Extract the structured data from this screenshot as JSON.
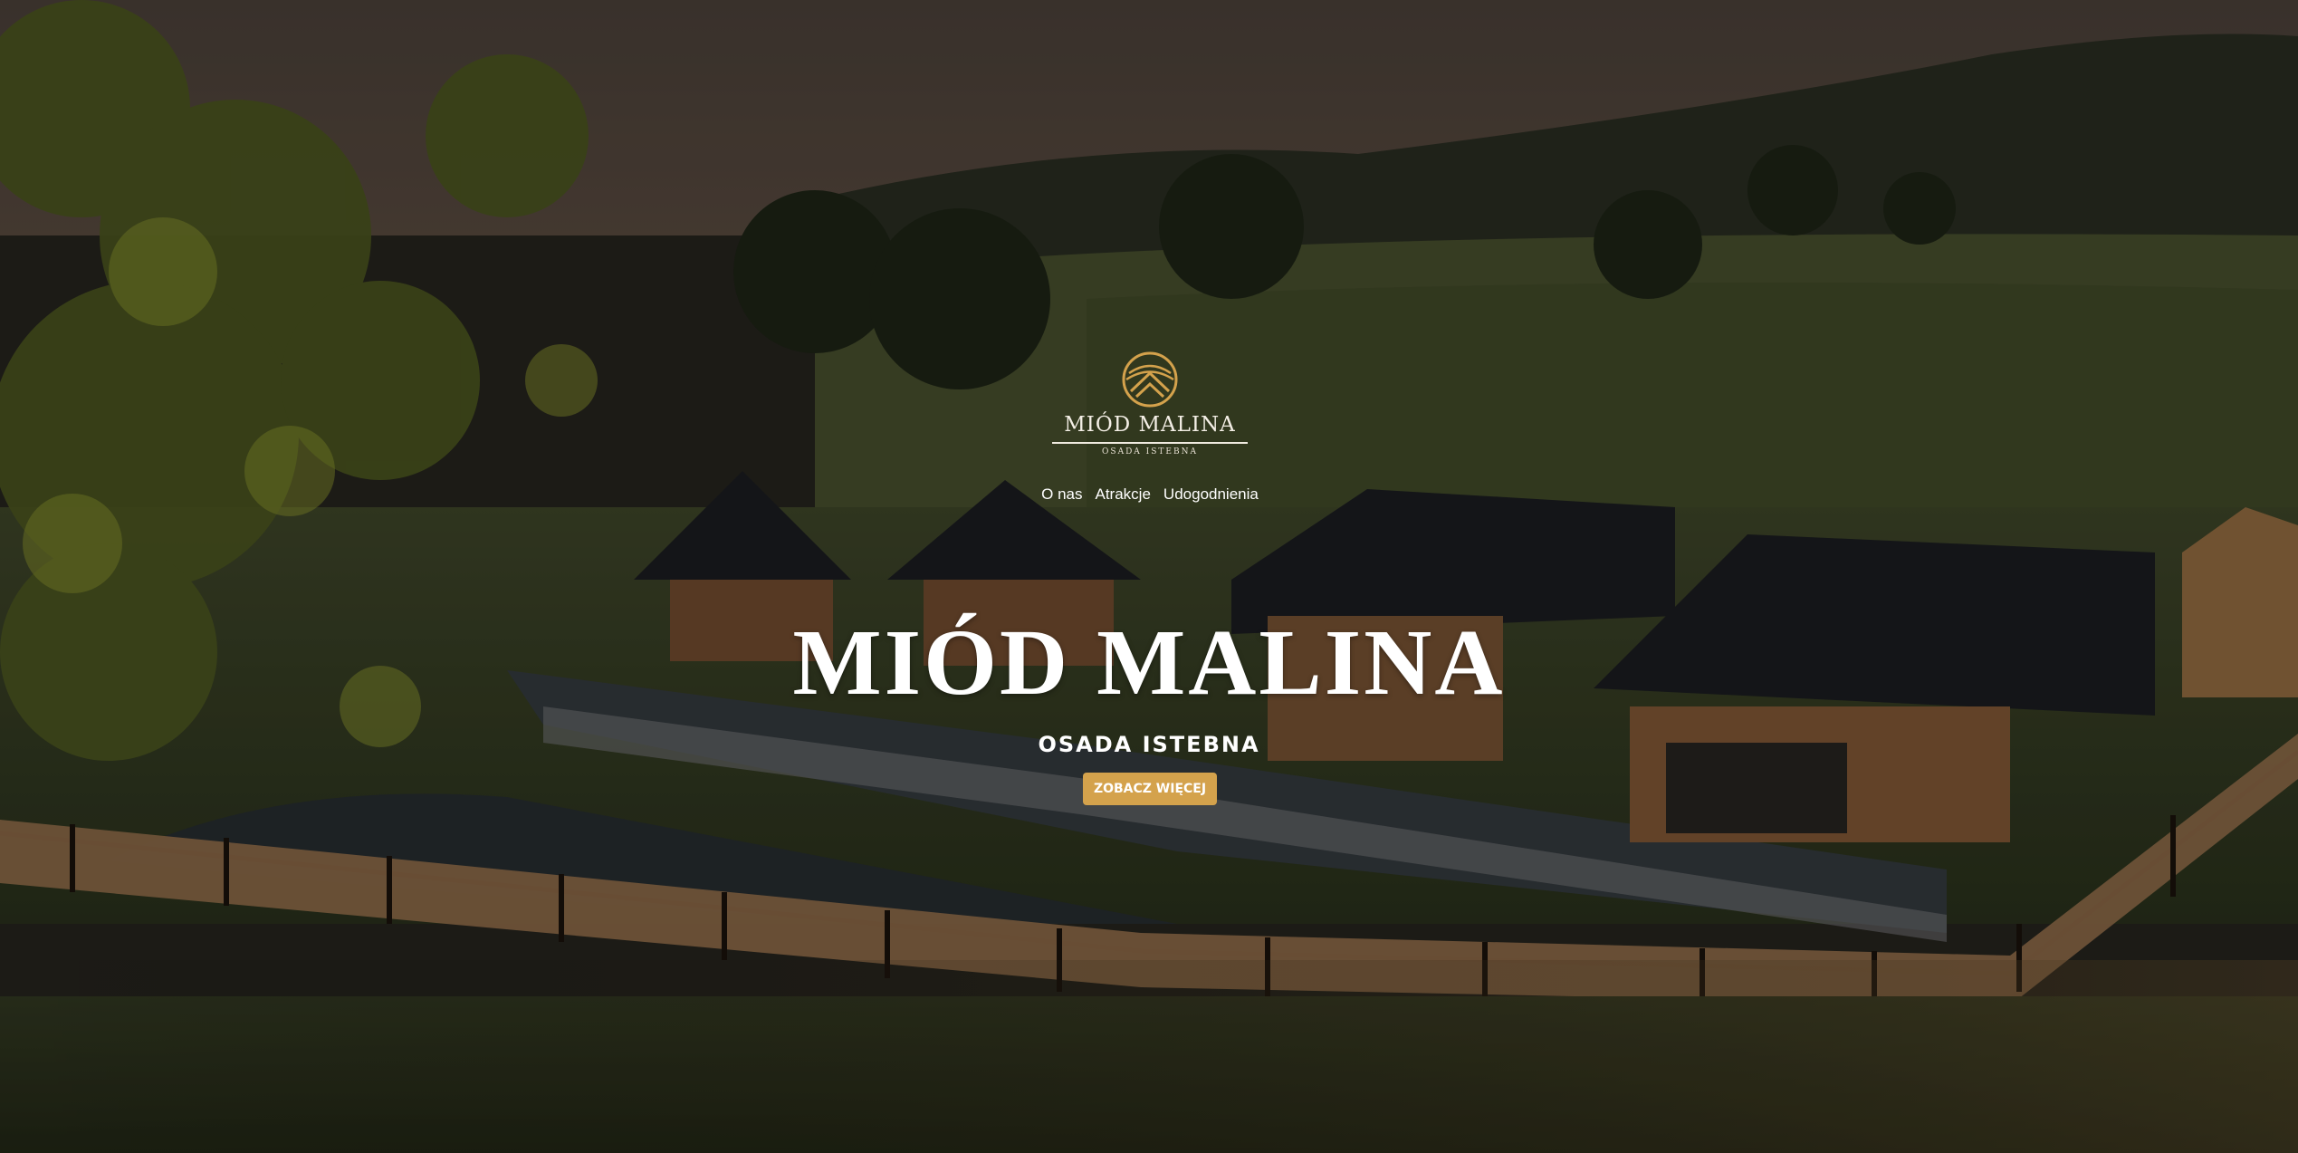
{
  "brand": {
    "name": "MIÓD MALINA",
    "tagline": "OSADA ISTEBNA",
    "logo_icon": "mountain-emblem-icon",
    "accent_color": "#d4a24c"
  },
  "nav": {
    "items": [
      {
        "label": "O nas"
      },
      {
        "label": "Atrakcje"
      },
      {
        "label": "Udogodnienia"
      }
    ]
  },
  "hero": {
    "title": "MIÓD MALINA",
    "subtitle": "OSADA ISTEBNA",
    "cta_label": "ZOBACZ WIĘCEJ"
  }
}
